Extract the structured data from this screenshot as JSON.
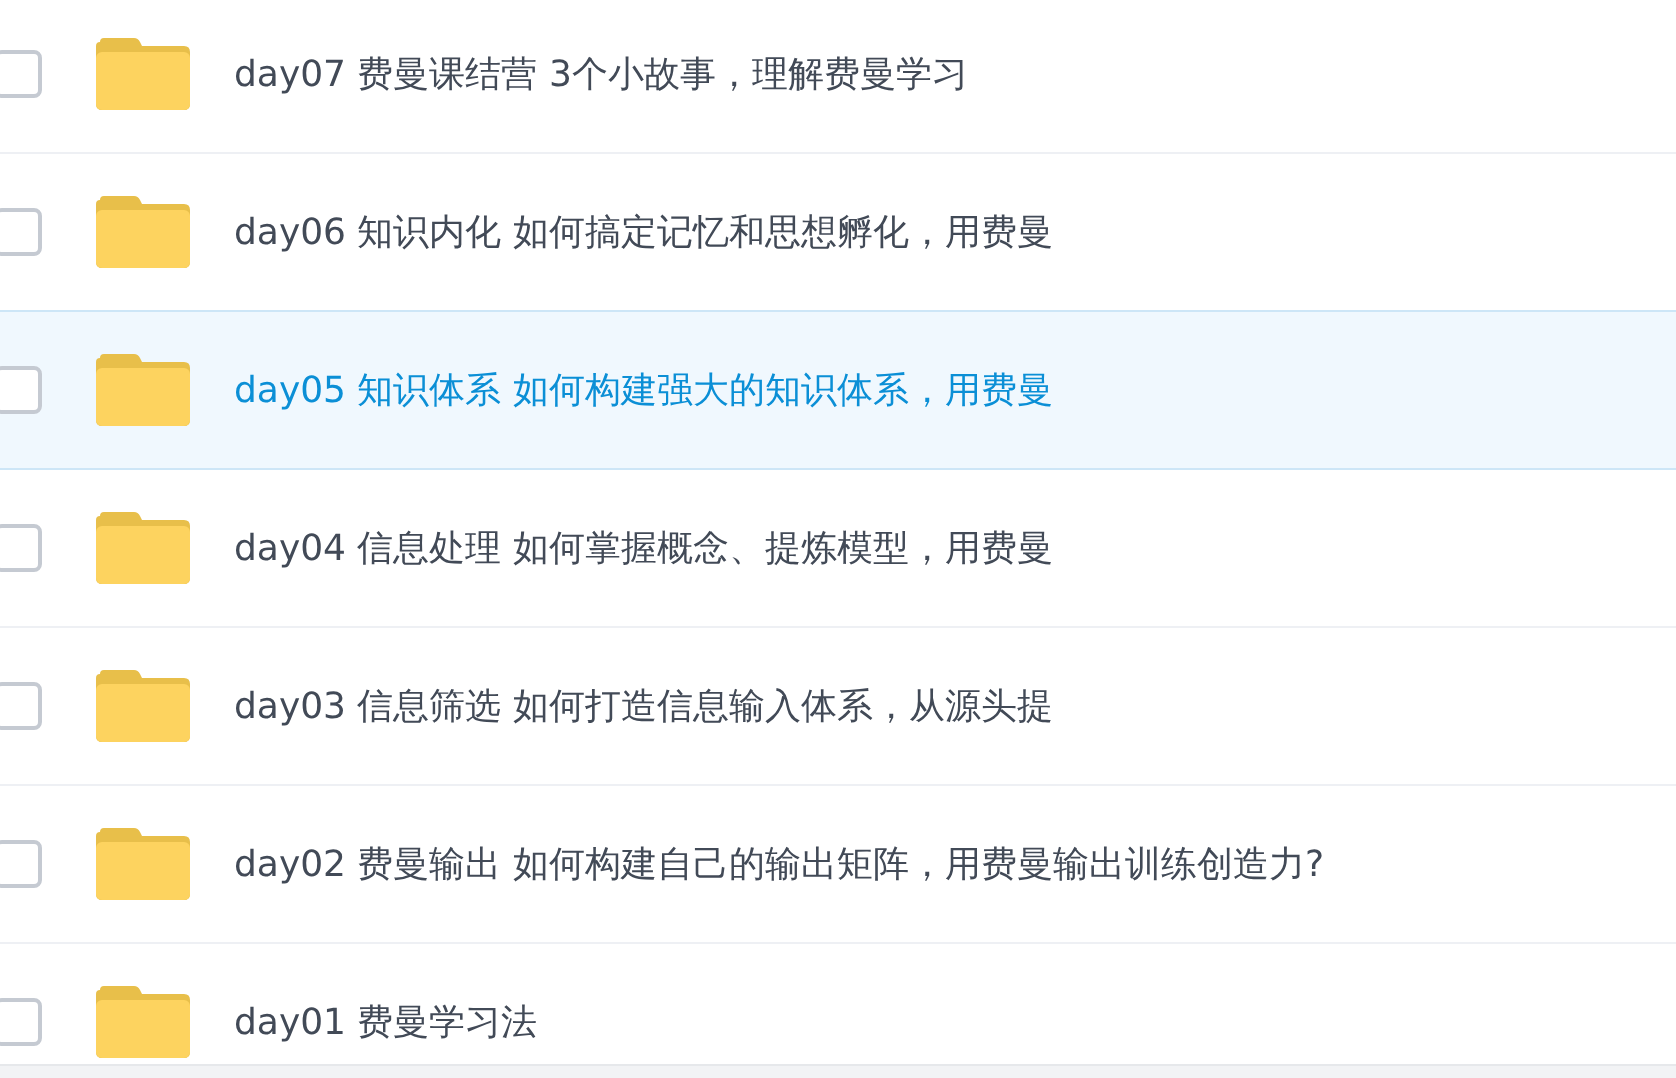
{
  "files": [
    {
      "name": "day07 费曼课结营 3个小故事，理解费曼学习",
      "checked": false,
      "selected": false
    },
    {
      "name": "day06 知识内化 如何搞定记忆和思想孵化，用费曼",
      "checked": false,
      "selected": false
    },
    {
      "name": "day05 知识体系 如何构建强大的知识体系，用费曼",
      "checked": false,
      "selected": true
    },
    {
      "name": "day04 信息处理 如何掌握概念、提炼模型，用费曼",
      "checked": false,
      "selected": false
    },
    {
      "name": "day03 信息筛选 如何打造信息输入体系，从源头提",
      "checked": false,
      "selected": false
    },
    {
      "name": "day02 费曼输出 如何构建自己的输出矩阵，用费曼输出训练创造力?",
      "checked": false,
      "selected": false
    },
    {
      "name": "day01 费曼学习法",
      "checked": false,
      "selected": false
    }
  ]
}
